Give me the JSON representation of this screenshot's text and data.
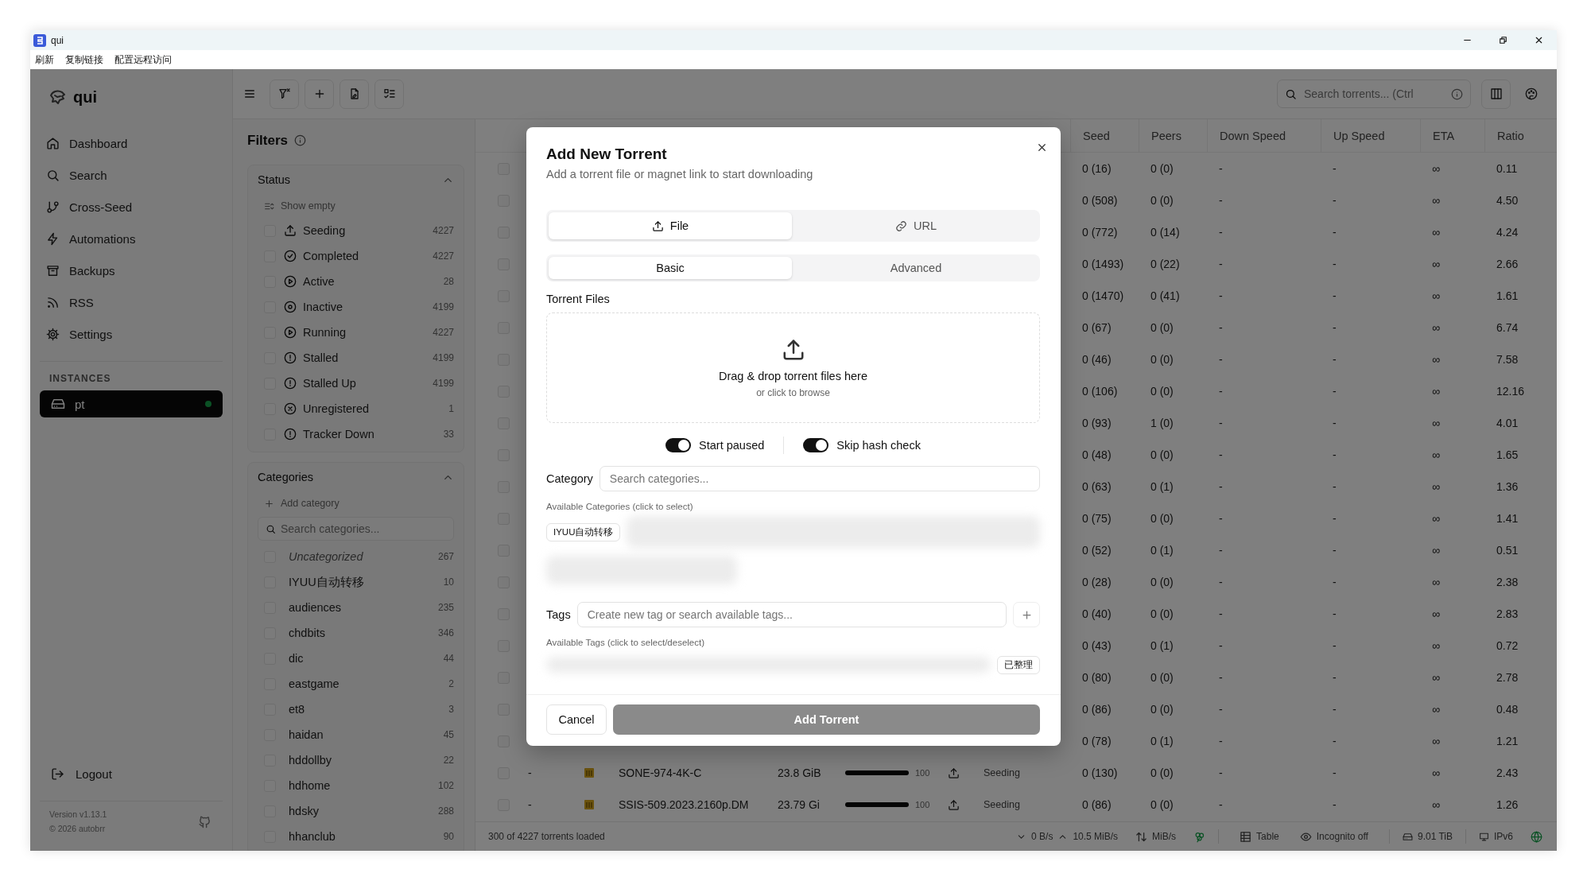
{
  "window": {
    "title": "qui"
  },
  "menu": [
    "刷新",
    "复制链接",
    "配置远程访问"
  ],
  "sidebar": {
    "brand": "qui",
    "nav": [
      {
        "label": "Dashboard",
        "kind": "home"
      },
      {
        "label": "Search",
        "kind": "search"
      },
      {
        "label": "Cross-Seed",
        "kind": "branch"
      },
      {
        "label": "Automations",
        "kind": "bolt"
      },
      {
        "label": "Backups",
        "kind": "archive"
      },
      {
        "label": "RSS",
        "kind": "rss"
      },
      {
        "label": "Settings",
        "kind": "gear"
      }
    ],
    "instances_heading": "INSTANCES",
    "instances": [
      {
        "name": "pt",
        "selected": true,
        "online": true
      }
    ],
    "logout": "Logout",
    "version": "Version v1.13.1",
    "copyright": "© 2026 autobrr"
  },
  "filters": {
    "title": "Filters",
    "status": {
      "title": "Status",
      "expanded": true,
      "show_empty": "Show empty",
      "items": [
        {
          "label": "Seeding",
          "count": "4227",
          "kind": "upload",
          "checked": false
        },
        {
          "label": "Completed",
          "count": "4227",
          "kind": "check",
          "checked": false
        },
        {
          "label": "Active",
          "count": "28",
          "kind": "play",
          "checked": false
        },
        {
          "label": "Inactive",
          "count": "4199",
          "kind": "target",
          "checked": false
        },
        {
          "label": "Running",
          "count": "4227",
          "kind": "play",
          "checked": false
        },
        {
          "label": "Stalled",
          "count": "4199",
          "kind": "alert",
          "checked": false
        },
        {
          "label": "Stalled Up",
          "count": "4199",
          "kind": "alert",
          "checked": false
        },
        {
          "label": "Unregistered",
          "count": "1",
          "kind": "cross",
          "checked": false
        },
        {
          "label": "Tracker Down",
          "count": "33",
          "kind": "alert",
          "checked": false
        }
      ]
    },
    "categories": {
      "title": "Categories",
      "expanded": true,
      "add": "Add category",
      "search_placeholder": "Search categories...",
      "items": [
        {
          "label": "Uncategorized",
          "count": "267",
          "kind": "uncategorized",
          "checked": false
        },
        {
          "label": "IYUU自动转移",
          "count": "10",
          "kind": "category",
          "checked": false
        },
        {
          "label": "audiences",
          "count": "235",
          "kind": "category",
          "checked": false
        },
        {
          "label": "chdbits",
          "count": "346",
          "kind": "category",
          "checked": false
        },
        {
          "label": "dic",
          "count": "44",
          "kind": "category",
          "checked": false
        },
        {
          "label": "eastgame",
          "count": "2",
          "kind": "category",
          "checked": false
        },
        {
          "label": "et8",
          "count": "3",
          "kind": "category",
          "checked": false
        },
        {
          "label": "haidan",
          "count": "45",
          "kind": "category",
          "checked": false
        },
        {
          "label": "hddollby",
          "count": "22",
          "kind": "category",
          "checked": false
        },
        {
          "label": "hdhome",
          "count": "102",
          "kind": "category",
          "checked": false
        },
        {
          "label": "hdsky",
          "count": "288",
          "kind": "category",
          "checked": false
        },
        {
          "label": "hhanclub",
          "count": "90",
          "kind": "category",
          "checked": false
        }
      ]
    }
  },
  "toolbar": {
    "search_placeholder": "Search torrents... (Ctrl"
  },
  "table": {
    "columns": [
      "Seed",
      "Peers",
      "Down Speed",
      "Up Speed",
      "ETA",
      "Ratio"
    ],
    "rows": [
      {
        "checked": false,
        "seed": "0 (16)",
        "peers": "0 (0)",
        "down": "-",
        "up": "-",
        "eta": "∞",
        "ratio": "0.11"
      },
      {
        "checked": false,
        "seed": "0 (508)",
        "peers": "0 (0)",
        "down": "-",
        "up": "-",
        "eta": "∞",
        "ratio": "4.50"
      },
      {
        "checked": false,
        "seed": "0 (772)",
        "peers": "0 (14)",
        "down": "-",
        "up": "-",
        "eta": "∞",
        "ratio": "4.24"
      },
      {
        "checked": false,
        "seed": "0 (1493)",
        "peers": "0 (22)",
        "down": "-",
        "up": "-",
        "eta": "∞",
        "ratio": "2.66"
      },
      {
        "checked": false,
        "seed": "0 (1470)",
        "peers": "0 (41)",
        "down": "-",
        "up": "-",
        "eta": "∞",
        "ratio": "1.61"
      },
      {
        "checked": false,
        "seed": "0 (67)",
        "peers": "0 (0)",
        "down": "-",
        "up": "-",
        "eta": "∞",
        "ratio": "6.74"
      },
      {
        "checked": false,
        "seed": "0 (46)",
        "peers": "0 (0)",
        "down": "-",
        "up": "-",
        "eta": "∞",
        "ratio": "7.58"
      },
      {
        "checked": false,
        "seed": "0 (106)",
        "peers": "0 (0)",
        "down": "-",
        "up": "-",
        "eta": "∞",
        "ratio": "12.16"
      },
      {
        "checked": false,
        "seed": "0 (93)",
        "peers": "1 (0)",
        "down": "-",
        "up": "-",
        "eta": "∞",
        "ratio": "4.01"
      },
      {
        "checked": false,
        "seed": "0 (48)",
        "peers": "0 (0)",
        "down": "-",
        "up": "-",
        "eta": "∞",
        "ratio": "1.65"
      },
      {
        "checked": false,
        "seed": "0 (63)",
        "peers": "0 (1)",
        "down": "-",
        "up": "-",
        "eta": "∞",
        "ratio": "1.36"
      },
      {
        "checked": false,
        "seed": "0 (75)",
        "peers": "0 (0)",
        "down": "-",
        "up": "-",
        "eta": "∞",
        "ratio": "1.41"
      },
      {
        "checked": false,
        "seed": "0 (52)",
        "peers": "0 (1)",
        "down": "-",
        "up": "-",
        "eta": "∞",
        "ratio": "0.51"
      },
      {
        "checked": false,
        "seed": "0 (28)",
        "peers": "0 (0)",
        "down": "-",
        "up": "-",
        "eta": "∞",
        "ratio": "2.38"
      },
      {
        "checked": false,
        "seed": "0 (40)",
        "peers": "0 (0)",
        "down": "-",
        "up": "-",
        "eta": "∞",
        "ratio": "2.83"
      },
      {
        "checked": false,
        "seed": "0 (43)",
        "peers": "0 (1)",
        "down": "-",
        "up": "-",
        "eta": "∞",
        "ratio": "0.72"
      },
      {
        "checked": false,
        "seed": "0 (80)",
        "peers": "0 (0)",
        "down": "-",
        "up": "-",
        "eta": "∞",
        "ratio": "2.78"
      },
      {
        "checked": false,
        "seed": "0 (86)",
        "peers": "0 (0)",
        "down": "-",
        "up": "-",
        "eta": "∞",
        "ratio": "0.48"
      },
      {
        "checked": false,
        "seed": "0 (78)",
        "peers": "0 (1)",
        "down": "-",
        "up": "-",
        "eta": "∞",
        "ratio": "1.21"
      },
      {
        "checked": false,
        "column_2": "-",
        "name": "SONE-974-4K-C",
        "size": "23.8 GiB",
        "level": 1,
        "progress": "100",
        "state": "Seeding",
        "seed": "0 (130)",
        "peers": "0 (0)",
        "down": "-",
        "up": "-",
        "eta": "∞",
        "ratio": "2.43"
      },
      {
        "checked": false,
        "column_2": "-",
        "name": "SSIS-509.2023.2160p.DM",
        "size": "23.79 Gi",
        "level": 1,
        "progress": "100",
        "state": "Seeding",
        "seed": "0 (86)",
        "peers": "0 (0)",
        "down": "-",
        "up": "-",
        "eta": "∞",
        "ratio": "1.26"
      }
    ]
  },
  "status_bar": {
    "loaded": "300 of 4227 torrents loaded",
    "down": "0 B/s",
    "up": "10.5 MiB/s",
    "limit": "MiB/s",
    "view": "Table",
    "incognito": "Incognito off",
    "disk": "9.01 TiB",
    "network": "IPv6"
  },
  "modal": {
    "title": "Add New Torrent",
    "subtitle": "Add a torrent file or magnet link to start downloading",
    "sources": [
      {
        "label": "File",
        "kind": "file",
        "selected": true
      },
      {
        "label": "URL",
        "kind": "url",
        "selected": false
      }
    ],
    "tabs": [
      {
        "label": "Basic",
        "selected": true
      },
      {
        "label": "Advanced",
        "selected": false
      }
    ],
    "files_label": "Torrent Files",
    "drop_title": "Drag & drop torrent files here",
    "drop_hint": "or click to browse",
    "toggles": [
      {
        "label": "Start paused",
        "on": true
      },
      {
        "label": "Skip hash check",
        "on": true
      }
    ],
    "category_label": "Category",
    "category_placeholder": "Search categories...",
    "available_categories_label": "Available Categories (click to select)",
    "category_chips": [
      "IYUU自动转移"
    ],
    "tags_label": "Tags",
    "tags_placeholder": "Create new tag or search available tags...",
    "available_tags_label": "Available Tags (click to select/deselect)",
    "tag_chips": [
      "已整理"
    ],
    "cancel": "Cancel",
    "submit": {
      "label": "Add Torrent",
      "disabled": true
    }
  }
}
